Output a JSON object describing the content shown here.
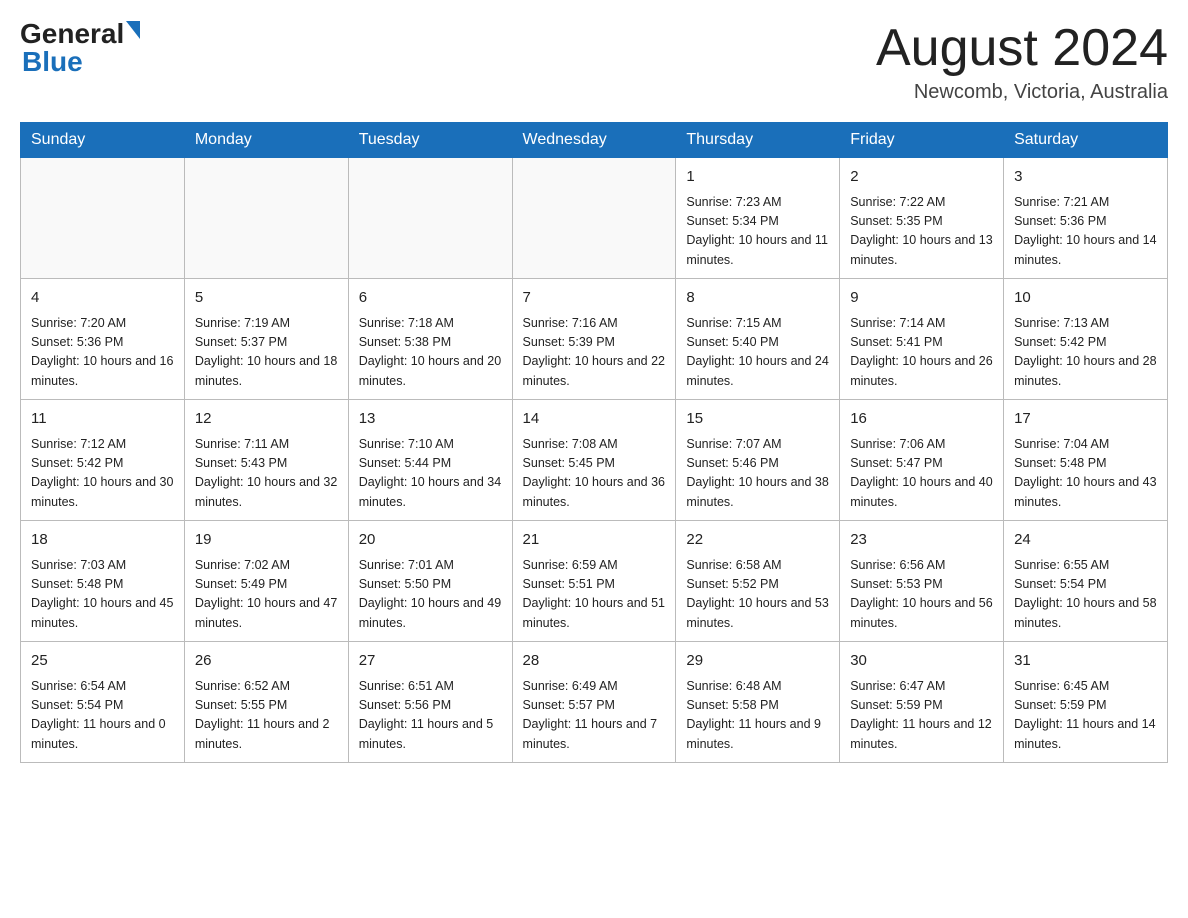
{
  "header": {
    "logo_text_general": "General",
    "logo_text_blue": "Blue",
    "month_title": "August 2024",
    "location": "Newcomb, Victoria, Australia"
  },
  "days_of_week": [
    "Sunday",
    "Monday",
    "Tuesday",
    "Wednesday",
    "Thursday",
    "Friday",
    "Saturday"
  ],
  "weeks": [
    [
      {
        "day": "",
        "info": ""
      },
      {
        "day": "",
        "info": ""
      },
      {
        "day": "",
        "info": ""
      },
      {
        "day": "",
        "info": ""
      },
      {
        "day": "1",
        "info": "Sunrise: 7:23 AM\nSunset: 5:34 PM\nDaylight: 10 hours and 11 minutes."
      },
      {
        "day": "2",
        "info": "Sunrise: 7:22 AM\nSunset: 5:35 PM\nDaylight: 10 hours and 13 minutes."
      },
      {
        "day": "3",
        "info": "Sunrise: 7:21 AM\nSunset: 5:36 PM\nDaylight: 10 hours and 14 minutes."
      }
    ],
    [
      {
        "day": "4",
        "info": "Sunrise: 7:20 AM\nSunset: 5:36 PM\nDaylight: 10 hours and 16 minutes."
      },
      {
        "day": "5",
        "info": "Sunrise: 7:19 AM\nSunset: 5:37 PM\nDaylight: 10 hours and 18 minutes."
      },
      {
        "day": "6",
        "info": "Sunrise: 7:18 AM\nSunset: 5:38 PM\nDaylight: 10 hours and 20 minutes."
      },
      {
        "day": "7",
        "info": "Sunrise: 7:16 AM\nSunset: 5:39 PM\nDaylight: 10 hours and 22 minutes."
      },
      {
        "day": "8",
        "info": "Sunrise: 7:15 AM\nSunset: 5:40 PM\nDaylight: 10 hours and 24 minutes."
      },
      {
        "day": "9",
        "info": "Sunrise: 7:14 AM\nSunset: 5:41 PM\nDaylight: 10 hours and 26 minutes."
      },
      {
        "day": "10",
        "info": "Sunrise: 7:13 AM\nSunset: 5:42 PM\nDaylight: 10 hours and 28 minutes."
      }
    ],
    [
      {
        "day": "11",
        "info": "Sunrise: 7:12 AM\nSunset: 5:42 PM\nDaylight: 10 hours and 30 minutes."
      },
      {
        "day": "12",
        "info": "Sunrise: 7:11 AM\nSunset: 5:43 PM\nDaylight: 10 hours and 32 minutes."
      },
      {
        "day": "13",
        "info": "Sunrise: 7:10 AM\nSunset: 5:44 PM\nDaylight: 10 hours and 34 minutes."
      },
      {
        "day": "14",
        "info": "Sunrise: 7:08 AM\nSunset: 5:45 PM\nDaylight: 10 hours and 36 minutes."
      },
      {
        "day": "15",
        "info": "Sunrise: 7:07 AM\nSunset: 5:46 PM\nDaylight: 10 hours and 38 minutes."
      },
      {
        "day": "16",
        "info": "Sunrise: 7:06 AM\nSunset: 5:47 PM\nDaylight: 10 hours and 40 minutes."
      },
      {
        "day": "17",
        "info": "Sunrise: 7:04 AM\nSunset: 5:48 PM\nDaylight: 10 hours and 43 minutes."
      }
    ],
    [
      {
        "day": "18",
        "info": "Sunrise: 7:03 AM\nSunset: 5:48 PM\nDaylight: 10 hours and 45 minutes."
      },
      {
        "day": "19",
        "info": "Sunrise: 7:02 AM\nSunset: 5:49 PM\nDaylight: 10 hours and 47 minutes."
      },
      {
        "day": "20",
        "info": "Sunrise: 7:01 AM\nSunset: 5:50 PM\nDaylight: 10 hours and 49 minutes."
      },
      {
        "day": "21",
        "info": "Sunrise: 6:59 AM\nSunset: 5:51 PM\nDaylight: 10 hours and 51 minutes."
      },
      {
        "day": "22",
        "info": "Sunrise: 6:58 AM\nSunset: 5:52 PM\nDaylight: 10 hours and 53 minutes."
      },
      {
        "day": "23",
        "info": "Sunrise: 6:56 AM\nSunset: 5:53 PM\nDaylight: 10 hours and 56 minutes."
      },
      {
        "day": "24",
        "info": "Sunrise: 6:55 AM\nSunset: 5:54 PM\nDaylight: 10 hours and 58 minutes."
      }
    ],
    [
      {
        "day": "25",
        "info": "Sunrise: 6:54 AM\nSunset: 5:54 PM\nDaylight: 11 hours and 0 minutes."
      },
      {
        "day": "26",
        "info": "Sunrise: 6:52 AM\nSunset: 5:55 PM\nDaylight: 11 hours and 2 minutes."
      },
      {
        "day": "27",
        "info": "Sunrise: 6:51 AM\nSunset: 5:56 PM\nDaylight: 11 hours and 5 minutes."
      },
      {
        "day": "28",
        "info": "Sunrise: 6:49 AM\nSunset: 5:57 PM\nDaylight: 11 hours and 7 minutes."
      },
      {
        "day": "29",
        "info": "Sunrise: 6:48 AM\nSunset: 5:58 PM\nDaylight: 11 hours and 9 minutes."
      },
      {
        "day": "30",
        "info": "Sunrise: 6:47 AM\nSunset: 5:59 PM\nDaylight: 11 hours and 12 minutes."
      },
      {
        "day": "31",
        "info": "Sunrise: 6:45 AM\nSunset: 5:59 PM\nDaylight: 11 hours and 14 minutes."
      }
    ]
  ]
}
